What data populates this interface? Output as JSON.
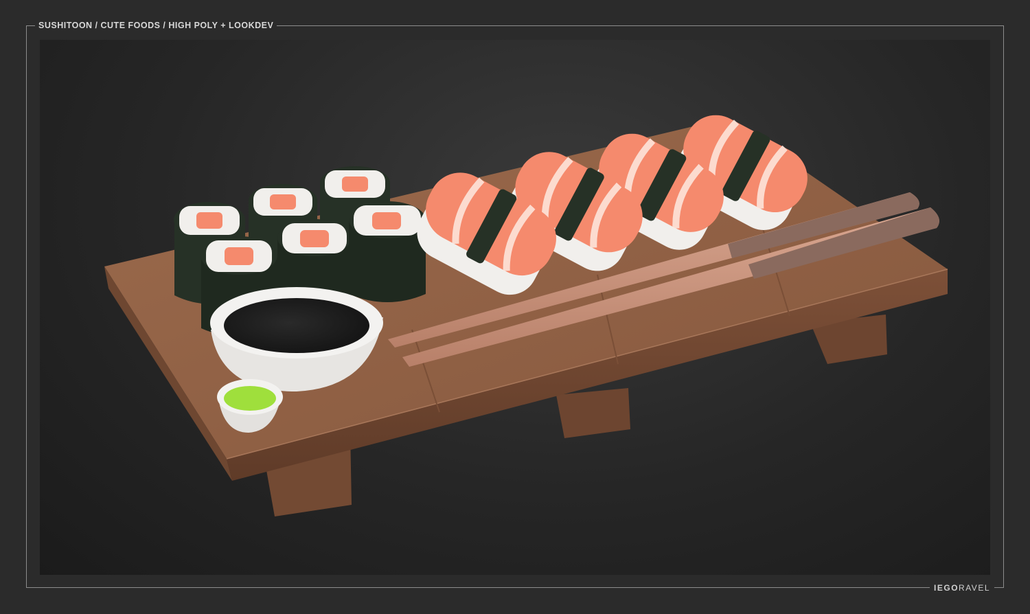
{
  "header": {
    "title": "SUSHITOON / CUTE FOODS / HIGH POLY + LOOKDEV"
  },
  "signature": {
    "logo_bold": "IEGO",
    "logo_light": "RAVEL"
  },
  "scene": {
    "subject": "sushi-board",
    "maki_count": 6,
    "nigiri_count": 4,
    "chopsticks_count": 2
  },
  "colors": {
    "background": "#2b2b2b",
    "frame": "#8d8d8d",
    "wood": "#8f5f43",
    "salmon": "#f58a6d",
    "rice": "#f1efec",
    "nori": "#263126",
    "soy": "#1c1c1c",
    "wasabi": "#9fdf3c"
  }
}
